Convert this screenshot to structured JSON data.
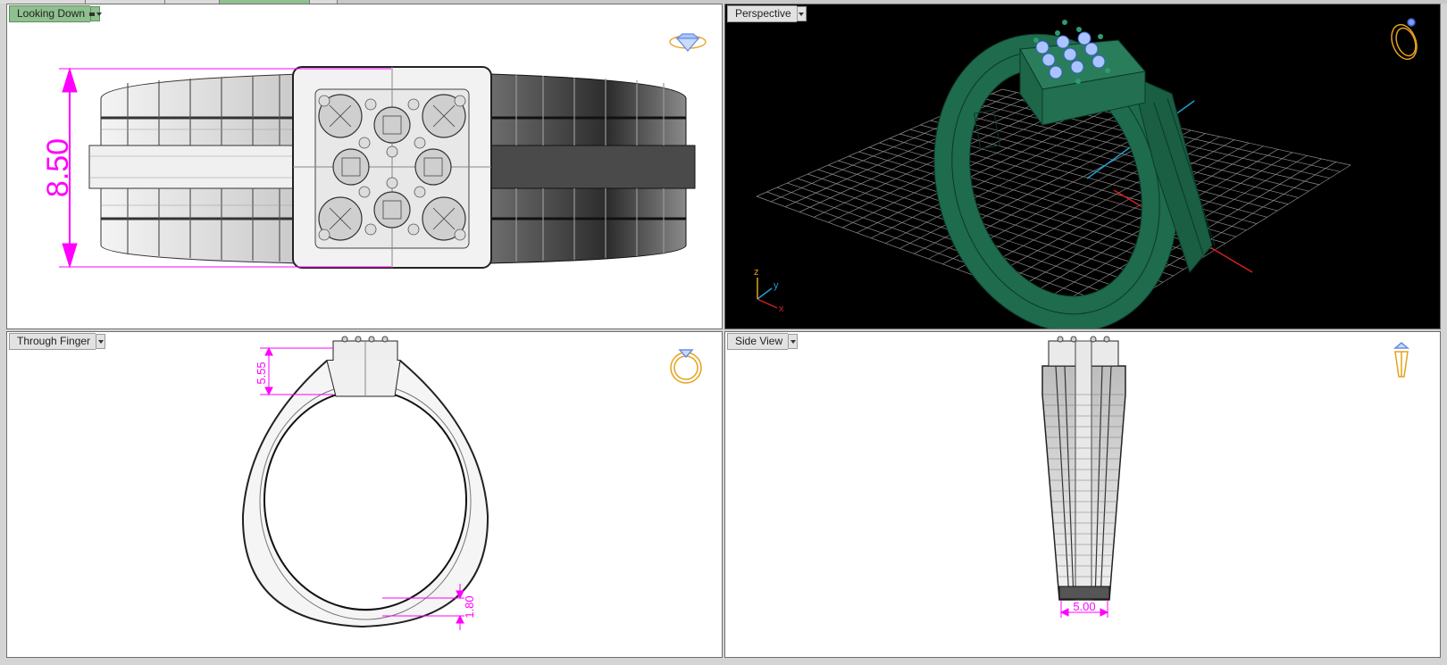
{
  "viewports": {
    "top_left": {
      "label": "Looking Down",
      "dimension": "8.50"
    },
    "top_right": {
      "label": "Perspective",
      "axes": {
        "x": "x",
        "y": "y",
        "z": "z"
      }
    },
    "bottom_left": {
      "label": "Through Finger",
      "dimension_top": "5.55",
      "dimension_bottom": "1.80"
    },
    "bottom_right": {
      "label": "Side View",
      "dimension": "5.00"
    }
  },
  "colors": {
    "active_tab": "#8fc08f",
    "dimension": "#ff00ff",
    "ring_green": "#1e6b4e",
    "gem_blue": "#8fb4ff",
    "orientation_gold": "#e6a21a",
    "grid": "#9a9a9a"
  },
  "icons": [
    "diamond-top-icon",
    "ring-perspective-icon",
    "ring-front-icon",
    "ring-side-icon",
    "dropdown-arrow-icon"
  ]
}
